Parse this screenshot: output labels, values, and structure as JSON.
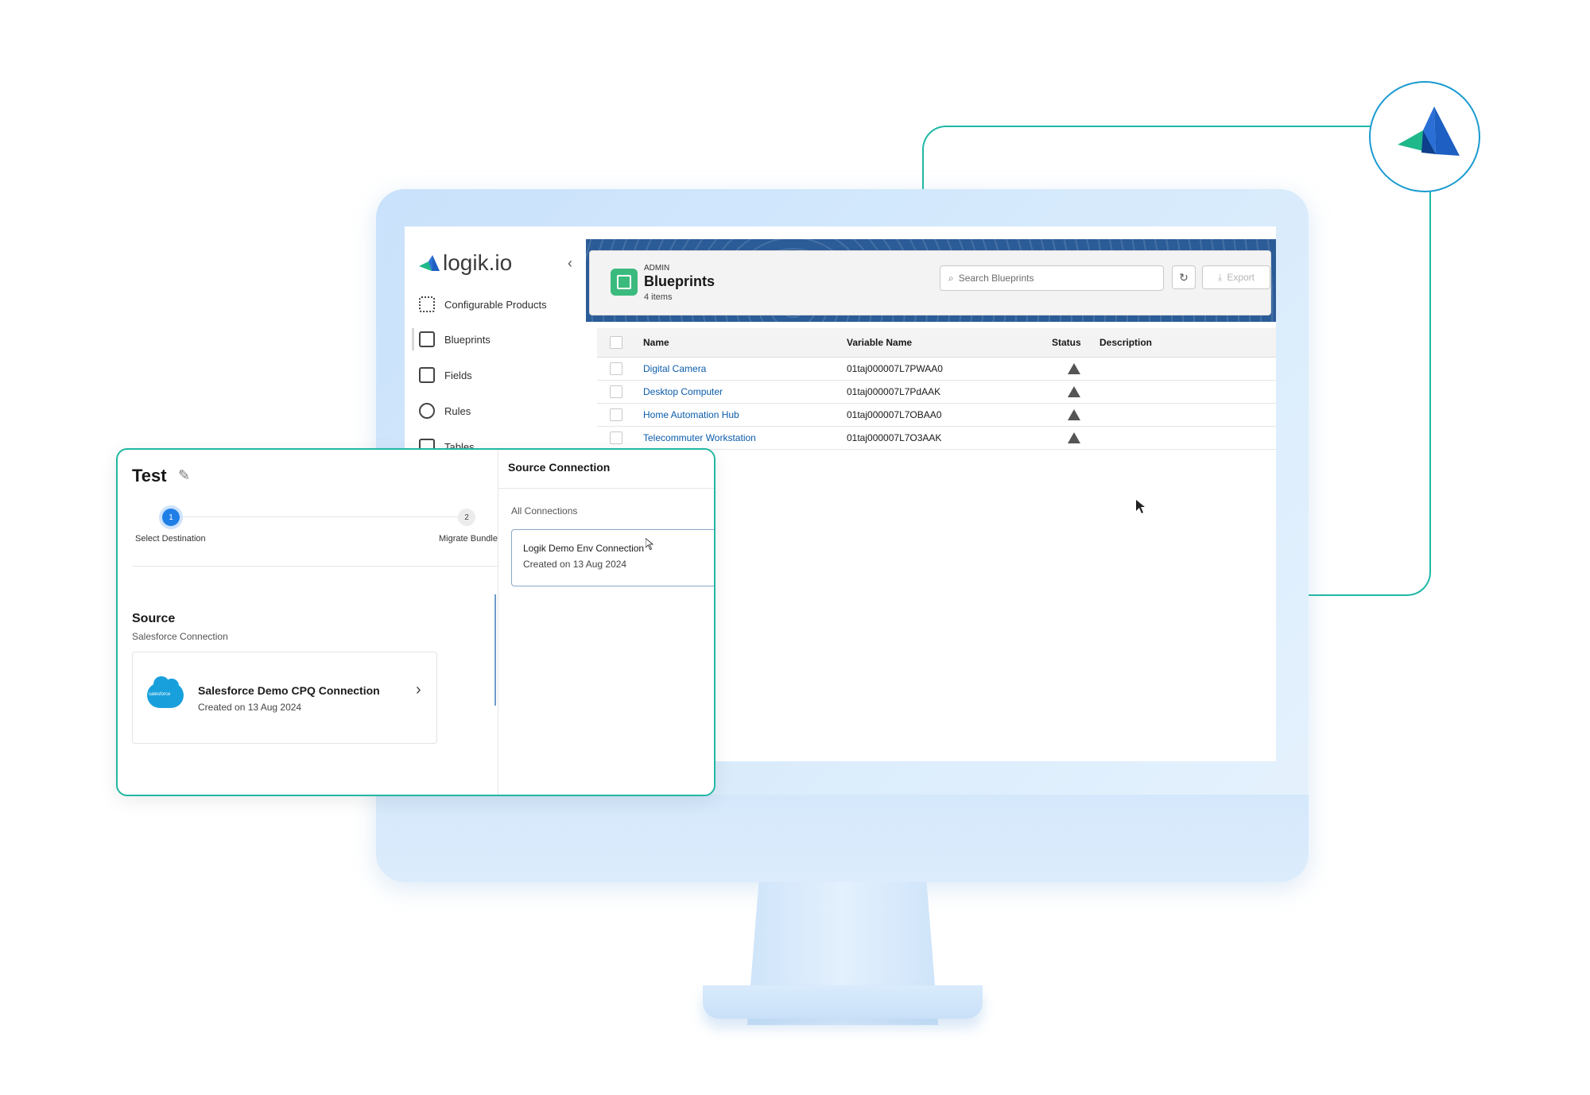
{
  "colors": {
    "accent_teal": "#22b7a3",
    "link_blue": "#0b5cab",
    "header_blue": "#2b5c98",
    "blueprint_green": "#3bba7d",
    "step_active": "#1f7fe6"
  },
  "sidebar": {
    "brand": "logik.io",
    "items": [
      {
        "label": "Configurable Products",
        "icon": "barcode-grid-icon"
      },
      {
        "label": "Blueprints",
        "icon": "blueprint-icon"
      },
      {
        "label": "Fields",
        "icon": "field-icon"
      },
      {
        "label": "Rules",
        "icon": "rules-network-icon"
      },
      {
        "label": "Tables",
        "icon": "table-icon"
      }
    ]
  },
  "header": {
    "eyebrow": "ADMIN",
    "title": "Blueprints",
    "count": "4 items",
    "search_placeholder": "Search Blueprints",
    "export_label": "Export"
  },
  "table": {
    "columns": [
      "Name",
      "Variable Name",
      "Status",
      "Description"
    ],
    "rows": [
      {
        "name": "Digital Camera",
        "variable": "01taj000007L7PWAA0",
        "status": "warning-icon",
        "description": ""
      },
      {
        "name": "Desktop Computer",
        "variable": "01taj000007L7PdAAK",
        "status": "warning-icon",
        "description": ""
      },
      {
        "name": "Home Automation Hub",
        "variable": "01taj000007L7OBAA0",
        "status": "warning-icon",
        "description": ""
      },
      {
        "name": "Telecommuter Workstation",
        "variable": "01taj000007L7O3AAK",
        "status": "warning-icon",
        "description": ""
      }
    ]
  },
  "dialog": {
    "title": "Test",
    "steps": [
      {
        "number": "1",
        "label": "Select Destination"
      },
      {
        "number": "2",
        "label": "Migrate Bundle"
      }
    ],
    "source": {
      "heading": "Source",
      "subheading": "Salesforce Connection",
      "card_title": "Salesforce Demo CPQ Connection",
      "card_date": "Created on 13 Aug 2024",
      "logo_text": "salesforce"
    },
    "panel": {
      "title": "Source Connection",
      "section": "All Connections",
      "connection_title": "Logik Demo Env Connection",
      "connection_date": "Created on 13 Aug 2024"
    }
  }
}
